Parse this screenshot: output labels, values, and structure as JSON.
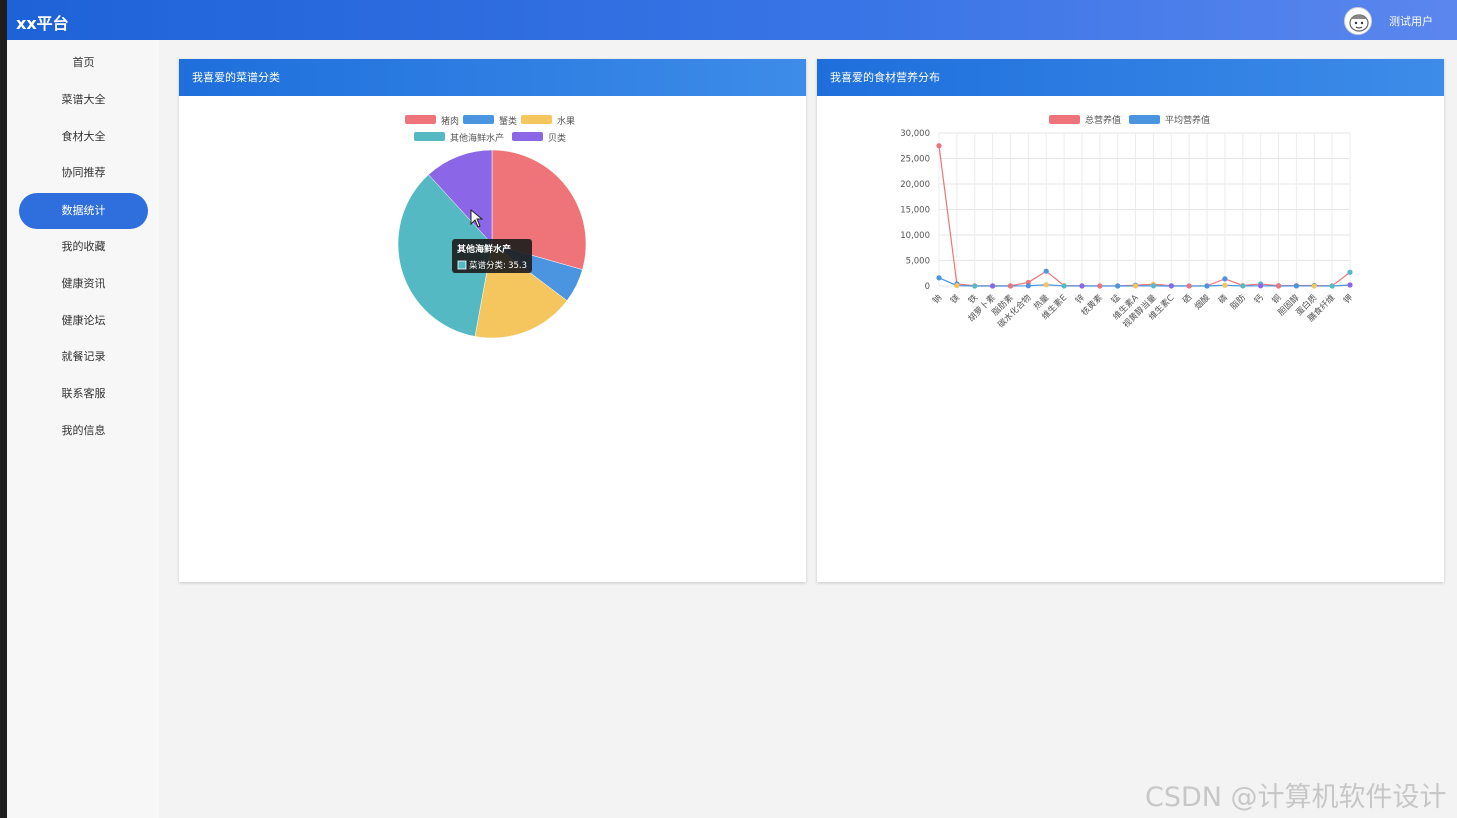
{
  "app": {
    "title": "xx平台",
    "user_name": "测试用户"
  },
  "sidebar": {
    "items": [
      {
        "label": "首页",
        "active": false
      },
      {
        "label": "菜谱大全",
        "active": false
      },
      {
        "label": "食材大全",
        "active": false
      },
      {
        "label": "协同推荐",
        "active": false
      },
      {
        "label": "数据统计",
        "active": true
      },
      {
        "label": "我的收藏",
        "active": false
      },
      {
        "label": "健康资讯",
        "active": false
      },
      {
        "label": "健康论坛",
        "active": false
      },
      {
        "label": "就餐记录",
        "active": false
      },
      {
        "label": "联系客服",
        "active": false
      },
      {
        "label": "我的信息",
        "active": false
      }
    ]
  },
  "colors": {
    "series_red": "#ee7479",
    "series_blue": "#4a94e0",
    "series_yellow": "#f5c55e",
    "series_teal": "#55b9c3",
    "series_purple": "#8b66e6",
    "accent": "#2f6fdd"
  },
  "cards": {
    "left_title": "我喜爱的菜谱分类",
    "right_title": "我喜爱的食材营养分布",
    "tooltip": {
      "title": "其他海鲜水产",
      "series": "菜谱分类",
      "value": "35.3"
    }
  },
  "chart_data": [
    {
      "type": "pie",
      "legend": [
        "猪肉",
        "蟹类",
        "水果",
        "其他海鲜水产",
        "贝类"
      ],
      "values": [
        29.4,
        5.9,
        17.6,
        35.3,
        11.8
      ],
      "legend_placement": "top-center"
    },
    {
      "type": "line",
      "legend": [
        "总营养值",
        "平均营养值"
      ],
      "categories": [
        "钠",
        "镁",
        "铁",
        "胡萝卜素",
        "脂肪素",
        "碳水化合物",
        "热量",
        "维生素E",
        "锌",
        "核黄素",
        "锰",
        "维生素A",
        "视黄醇当量",
        "维生素C",
        "硒",
        "烟酸",
        "磷",
        "脂肪",
        "钙",
        "铜",
        "胆固醇",
        "蛋白质",
        "膳食纤维",
        "钾"
      ],
      "y_ticks": [
        "0",
        "5,000",
        "10,000",
        "15,000",
        "20,000",
        "25,000",
        "30,000"
      ],
      "ylim": [
        0,
        30000
      ],
      "series": [
        {
          "name": "总营养值",
          "values": [
            27500,
            400,
            50,
            20,
            30,
            700,
            2900,
            80,
            30,
            10,
            20,
            150,
            350,
            60,
            10,
            40,
            1400,
            100,
            400,
            50,
            80,
            100,
            40,
            2700
          ]
        },
        {
          "name": "平均营养值",
          "values": [
            1600,
            80,
            5,
            2,
            3,
            40,
            250,
            8,
            3,
            1,
            2,
            15,
            30,
            6,
            1,
            4,
            150,
            10,
            40,
            5,
            8,
            10,
            4,
            200
          ]
        }
      ],
      "grid": true,
      "legend_placement": "top-center"
    }
  ],
  "watermark": "CSDN @计算机软件设计"
}
